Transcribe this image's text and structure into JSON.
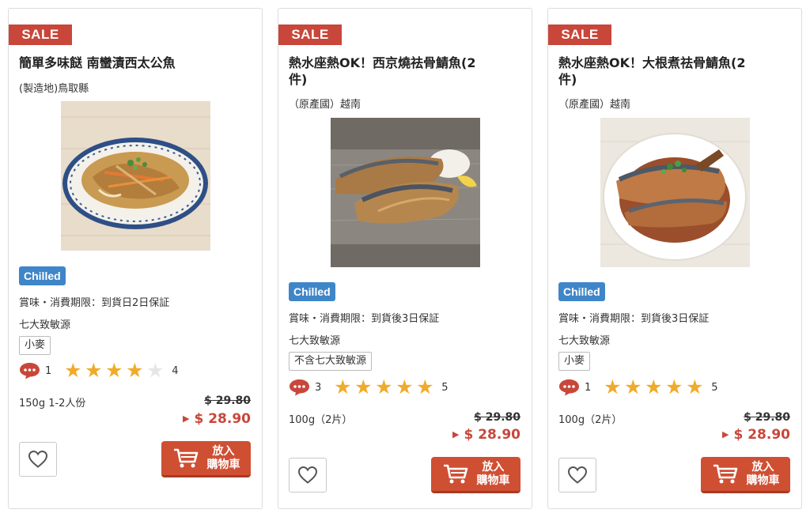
{
  "colors": {
    "sale": "#c8473a",
    "chilled": "#3f86c8",
    "price": "#c8473a",
    "cart": "#cf4f33",
    "star_on": "#f0ab2a",
    "star_off": "#e6e6e6"
  },
  "products": [
    {
      "sale_label": "SALE",
      "title_lines": [
        "簡單多味餸 南蠻漬西太公魚"
      ],
      "origin": "(製造地)鳥取縣",
      "temperature": "Chilled",
      "expiry": "賞味・消費期限：到貨日2日保証",
      "allergen_heading": "七大致敏源",
      "allergen_tag": "小麥",
      "comment_count": "1",
      "rating": 4,
      "rating_label": "4",
      "size": "150g  1-2人份",
      "old_price": "$ 29.80",
      "new_price": "$ 28.90",
      "cart_line1": "放入",
      "cart_line2": "購物車",
      "icons": {
        "comment": "comment-bubble-icon",
        "favorite": "heart-icon",
        "cart": "shopping-cart-icon"
      }
    },
    {
      "sale_label": "SALE",
      "title_lines": [
        "熱水座熱OK！西京燒祛骨鯖魚(2",
        "件)"
      ],
      "origin": "（原產國）越南",
      "temperature": "Chilled",
      "expiry": "賞味・消費期限：到貨後3日保証",
      "allergen_heading": "七大致敏源",
      "allergen_tag": "不含七大致敏源",
      "comment_count": "3",
      "rating": 5,
      "rating_label": "5",
      "size": "100g（2片）",
      "old_price": "$ 29.80",
      "new_price": "$ 28.90",
      "cart_line1": "放入",
      "cart_line2": "購物車",
      "icons": {
        "comment": "comment-bubble-icon",
        "favorite": "heart-icon",
        "cart": "shopping-cart-icon"
      }
    },
    {
      "sale_label": "SALE",
      "title_lines": [
        "熱水座熱OK！大根煮祛骨鯖魚(2",
        "件)"
      ],
      "origin": "（原產國）越南",
      "temperature": "Chilled",
      "expiry": "賞味・消費期限：到貨後3日保証",
      "allergen_heading": "七大致敏源",
      "allergen_tag": "小麥",
      "comment_count": "1",
      "rating": 5,
      "rating_label": "5",
      "size": "100g（2片）",
      "old_price": "$ 29.80",
      "new_price": "$ 28.90",
      "cart_line1": "放入",
      "cart_line2": "購物車",
      "icons": {
        "comment": "comment-bubble-icon",
        "favorite": "heart-icon",
        "cart": "shopping-cart-icon"
      }
    }
  ]
}
